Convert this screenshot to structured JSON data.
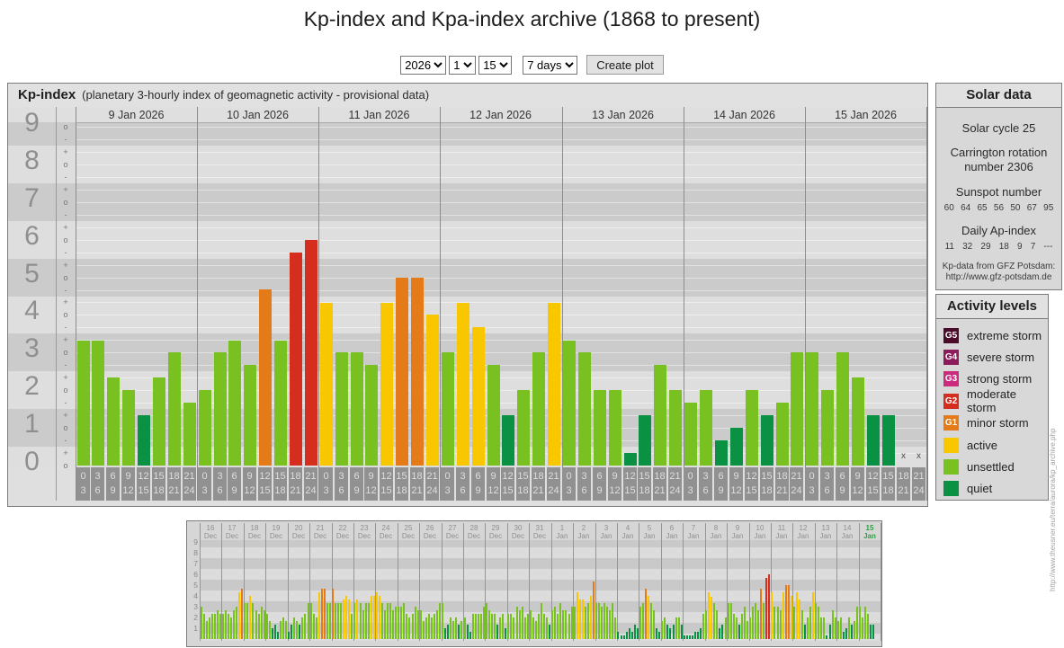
{
  "page": {
    "title": "Kp-index and Kpa-index archive (1868 to present)"
  },
  "controls": {
    "year": "2026",
    "month": "1",
    "day": "15",
    "period": "7 days",
    "create_button_label": "Create plot"
  },
  "kp_panel": {
    "title": "Kp-index",
    "subtitle": "(planetary 3-hourly index of geomagnetic activity - provisional data)"
  },
  "solar_data": {
    "title": "Solar data",
    "solar_cycle": "Solar cycle 25",
    "carrington": "Carrington rotation number 2306",
    "sunspot_label": "Sunspot number",
    "sunspot_values": [
      "60",
      "64",
      "65",
      "56",
      "50",
      "67",
      "95"
    ],
    "ap_label": "Daily Ap-index",
    "ap_values": [
      "11",
      "32",
      "29",
      "18",
      "9",
      "7",
      "---"
    ],
    "source_line1": "Kp-data from GFZ Potsdam:",
    "source_line2": "http://www.gfz-potsdam.de"
  },
  "activity_levels": {
    "title": "Activity levels",
    "items": [
      {
        "badge": "G5",
        "label": "extreme storm",
        "color": "#4a0c28"
      },
      {
        "badge": "G4",
        "label": "severe storm",
        "color": "#8e1b5b"
      },
      {
        "badge": "G3",
        "label": "strong storm",
        "color": "#cc2a7d"
      },
      {
        "badge": "G2",
        "label": "moderate storm",
        "color": "#d52d1e"
      },
      {
        "badge": "G1",
        "label": "minor storm",
        "color": "#e47a18"
      },
      {
        "badge": "",
        "label": "active",
        "color": "#f8c700"
      },
      {
        "badge": "",
        "label": "unsettled",
        "color": "#78c120"
      },
      {
        "badge": "",
        "label": "quiet",
        "color": "#0b9144"
      }
    ]
  },
  "watermark": "http://www.theusner.eu/terra/aurora/kp_archive.php",
  "colors": {
    "quiet": "#0b9144",
    "unsettled": "#78c120",
    "active": "#f8c700",
    "g1": "#e47a18",
    "g2": "#d52d1e",
    "g3": "#cc2a7d",
    "g4": "#8e1b5b",
    "g5": "#4a0c28",
    "band_light": "#dedede",
    "band_dark": "#cbcbcb"
  },
  "chart_data": [
    {
      "type": "bar",
      "title": "Kp-index",
      "subtitle": "planetary 3-hourly index of geomagnetic activity - provisional data",
      "ylabel": "Kp",
      "ylim": [
        0,
        9.5
      ],
      "y_ticks": [
        "9",
        "8",
        "7",
        "6",
        "5",
        "4",
        "3",
        "2",
        "1",
        "0"
      ],
      "hour_slots": [
        [
          "0",
          "3"
        ],
        [
          "3",
          "6"
        ],
        [
          "6",
          "9"
        ],
        [
          "9",
          "12"
        ],
        [
          "12",
          "15"
        ],
        [
          "15",
          "18"
        ],
        [
          "18",
          "21"
        ],
        [
          "21",
          "24"
        ]
      ],
      "no_data_marker": "x",
      "days": [
        {
          "date": "9 Jan 2026",
          "kp_labels": [
            "3+",
            "3+",
            "2+",
            "2o",
            "1+",
            "2+",
            "3o",
            "2-"
          ],
          "values": [
            3.33,
            3.33,
            2.33,
            2,
            1.33,
            2.33,
            3,
            1.67
          ]
        },
        {
          "date": "10 Jan 2026",
          "kp_labels": [
            "2o",
            "3o",
            "3+",
            "3-",
            "5-",
            "3+",
            "6-",
            "6o"
          ],
          "values": [
            2,
            3,
            3.33,
            2.67,
            4.67,
            3.33,
            5.67,
            6
          ]
        },
        {
          "date": "11 Jan 2026",
          "kp_labels": [
            "4+",
            "3o",
            "3o",
            "3-",
            "4+",
            "5o",
            "5o",
            "4o"
          ],
          "values": [
            4.33,
            3,
            3,
            2.67,
            4.33,
            5,
            5,
            4
          ]
        },
        {
          "date": "12 Jan 2026",
          "kp_labels": [
            "3o",
            "4+",
            "4-",
            "3-",
            "1+",
            "2o",
            "3o",
            "4+"
          ],
          "values": [
            3,
            4.33,
            3.67,
            2.67,
            1.33,
            2,
            3,
            4.33
          ]
        },
        {
          "date": "13 Jan 2026",
          "kp_labels": [
            "3+",
            "3o",
            "2o",
            "2o",
            "0+",
            "1+",
            "3-",
            "2o"
          ],
          "values": [
            3.33,
            3,
            2,
            2,
            0.33,
            1.33,
            2.67,
            2
          ]
        },
        {
          "date": "14 Jan 2026",
          "kp_labels": [
            "2-",
            "2o",
            "1-",
            "1o",
            "2o",
            "1+",
            "2-",
            "3o"
          ],
          "values": [
            1.67,
            2,
            0.67,
            1,
            2,
            1.33,
            1.67,
            3
          ]
        },
        {
          "date": "15 Jan 2026",
          "kp_labels": [
            "3o",
            "2o",
            "3o",
            "2+",
            "1+",
            "1+",
            "x",
            "x"
          ],
          "values": [
            3,
            2,
            3,
            2.33,
            1.33,
            1.33,
            null,
            null
          ]
        }
      ]
    },
    {
      "type": "bar",
      "title": "",
      "ylim": [
        0,
        9.5
      ],
      "y_ticks": [
        "9",
        "8",
        "7",
        "6",
        "5",
        "4",
        "3",
        "2",
        "1"
      ],
      "highlight_last_day": true,
      "days": [
        {
          "day": "16",
          "month": "Dec",
          "values": [
            3.0,
            2.3,
            1.7,
            2.0,
            2.3,
            2.3,
            2.7,
            2.3
          ]
        },
        {
          "day": "17",
          "month": "Dec",
          "values": [
            2.3,
            2.7,
            2.3,
            2.0,
            2.7,
            3.0,
            4.3,
            4.7
          ]
        },
        {
          "day": "18",
          "month": "Dec",
          "values": [
            3.3,
            3.3,
            4.0,
            3.3,
            2.7,
            2.3,
            3.0,
            2.7
          ]
        },
        {
          "day": "19",
          "month": "Dec",
          "values": [
            2.3,
            1.7,
            1.0,
            1.3,
            0.7,
            1.7,
            2.0,
            1.7
          ]
        },
        {
          "day": "20",
          "month": "Dec",
          "values": [
            0.7,
            1.3,
            2.0,
            1.7,
            1.3,
            2.0,
            2.3,
            3.3
          ]
        },
        {
          "day": "21",
          "month": "Dec",
          "values": [
            3.3,
            2.3,
            2.0,
            4.3,
            4.7,
            4.7,
            3.3,
            3.3
          ]
        },
        {
          "day": "22",
          "month": "Dec",
          "values": [
            4.7,
            3.3,
            3.3,
            3.3,
            3.7,
            4.0,
            3.7,
            2.3
          ]
        },
        {
          "day": "23",
          "month": "Dec",
          "values": [
            3.3,
            3.7,
            3.3,
            2.7,
            3.3,
            3.3,
            4.0,
            4.0
          ]
        },
        {
          "day": "24",
          "month": "Dec",
          "values": [
            4.3,
            4.0,
            3.3,
            2.7,
            3.3,
            3.3,
            2.7,
            3.0
          ]
        },
        {
          "day": "25",
          "month": "Dec",
          "values": [
            3.0,
            3.0,
            3.3,
            2.3,
            2.0,
            2.3,
            3.0,
            2.7
          ]
        },
        {
          "day": "26",
          "month": "Dec",
          "values": [
            2.7,
            1.7,
            2.0,
            2.3,
            2.0,
            2.3,
            2.7,
            3.3
          ]
        },
        {
          "day": "27",
          "month": "Dec",
          "values": [
            3.3,
            1.0,
            1.3,
            2.0,
            1.7,
            2.0,
            1.3,
            1.7
          ]
        },
        {
          "day": "28",
          "month": "Dec",
          "values": [
            2.0,
            1.3,
            0.7,
            2.3,
            2.3,
            2.3,
            2.3,
            3.0
          ]
        },
        {
          "day": "29",
          "month": "Dec",
          "values": [
            3.3,
            2.7,
            2.3,
            2.3,
            1.3,
            2.0,
            2.3,
            1.0
          ]
        },
        {
          "day": "30",
          "month": "Dec",
          "values": [
            2.3,
            2.3,
            2.0,
            3.0,
            2.7,
            3.0,
            2.0,
            2.3
          ]
        },
        {
          "day": "31",
          "month": "Dec",
          "values": [
            2.7,
            2.0,
            1.7,
            2.3,
            3.3,
            2.3,
            2.0,
            1.3
          ]
        },
        {
          "day": "1",
          "month": "Jan",
          "values": [
            2.7,
            3.0,
            2.3,
            3.3,
            2.7,
            2.7,
            2.3,
            3.0
          ]
        },
        {
          "day": "2",
          "month": "Jan",
          "values": [
            3.0,
            4.3,
            3.7,
            3.7,
            3.0,
            3.3,
            4.0,
            5.3
          ]
        },
        {
          "day": "3",
          "month": "Jan",
          "values": [
            3.3,
            3.3,
            3.0,
            3.3,
            3.0,
            2.7,
            3.3,
            2.0
          ]
        },
        {
          "day": "4",
          "month": "Jan",
          "values": [
            0.7,
            0.3,
            0.3,
            0.7,
            1.0,
            0.7,
            1.3,
            1.0
          ]
        },
        {
          "day": "5",
          "month": "Jan",
          "values": [
            3.0,
            3.3,
            4.7,
            4.0,
            3.3,
            2.7,
            1.0,
            0.7
          ]
        },
        {
          "day": "6",
          "month": "Jan",
          "values": [
            1.7,
            2.0,
            1.3,
            1.0,
            1.3,
            2.0,
            2.0,
            1.3
          ]
        },
        {
          "day": "7",
          "month": "Jan",
          "values": [
            0.3,
            0.3,
            0.3,
            0.3,
            0.7,
            0.7,
            1.0,
            2.3
          ]
        },
        {
          "day": "8",
          "month": "Jan",
          "values": [
            2.7,
            4.3,
            3.9,
            3.3,
            2.7,
            1.0,
            1.3,
            2.0
          ]
        },
        {
          "day": "9",
          "month": "Jan",
          "values": [
            3.3,
            3.3,
            2.3,
            2.0,
            1.3,
            2.3,
            3.0,
            1.7
          ]
        },
        {
          "day": "10",
          "month": "Jan",
          "values": [
            2.0,
            3.0,
            3.3,
            2.7,
            4.7,
            3.3,
            5.7,
            6.0
          ]
        },
        {
          "day": "11",
          "month": "Jan",
          "values": [
            4.3,
            3.0,
            3.0,
            2.7,
            4.3,
            5.0,
            5.0,
            4.0
          ]
        },
        {
          "day": "12",
          "month": "Jan",
          "values": [
            3.0,
            4.3,
            3.7,
            2.7,
            1.3,
            2.0,
            3.0,
            4.3
          ]
        },
        {
          "day": "13",
          "month": "Jan",
          "values": [
            3.3,
            3.0,
            2.0,
            2.0,
            0.3,
            1.3,
            2.7,
            2.0
          ]
        },
        {
          "day": "14",
          "month": "Jan",
          "values": [
            1.7,
            2.0,
            0.7,
            1.0,
            2.0,
            1.3,
            1.7,
            3.0
          ]
        },
        {
          "day": "15",
          "month": "Jan",
          "values": [
            3.0,
            2.0,
            3.0,
            2.3,
            1.3,
            1.3
          ]
        }
      ]
    }
  ]
}
